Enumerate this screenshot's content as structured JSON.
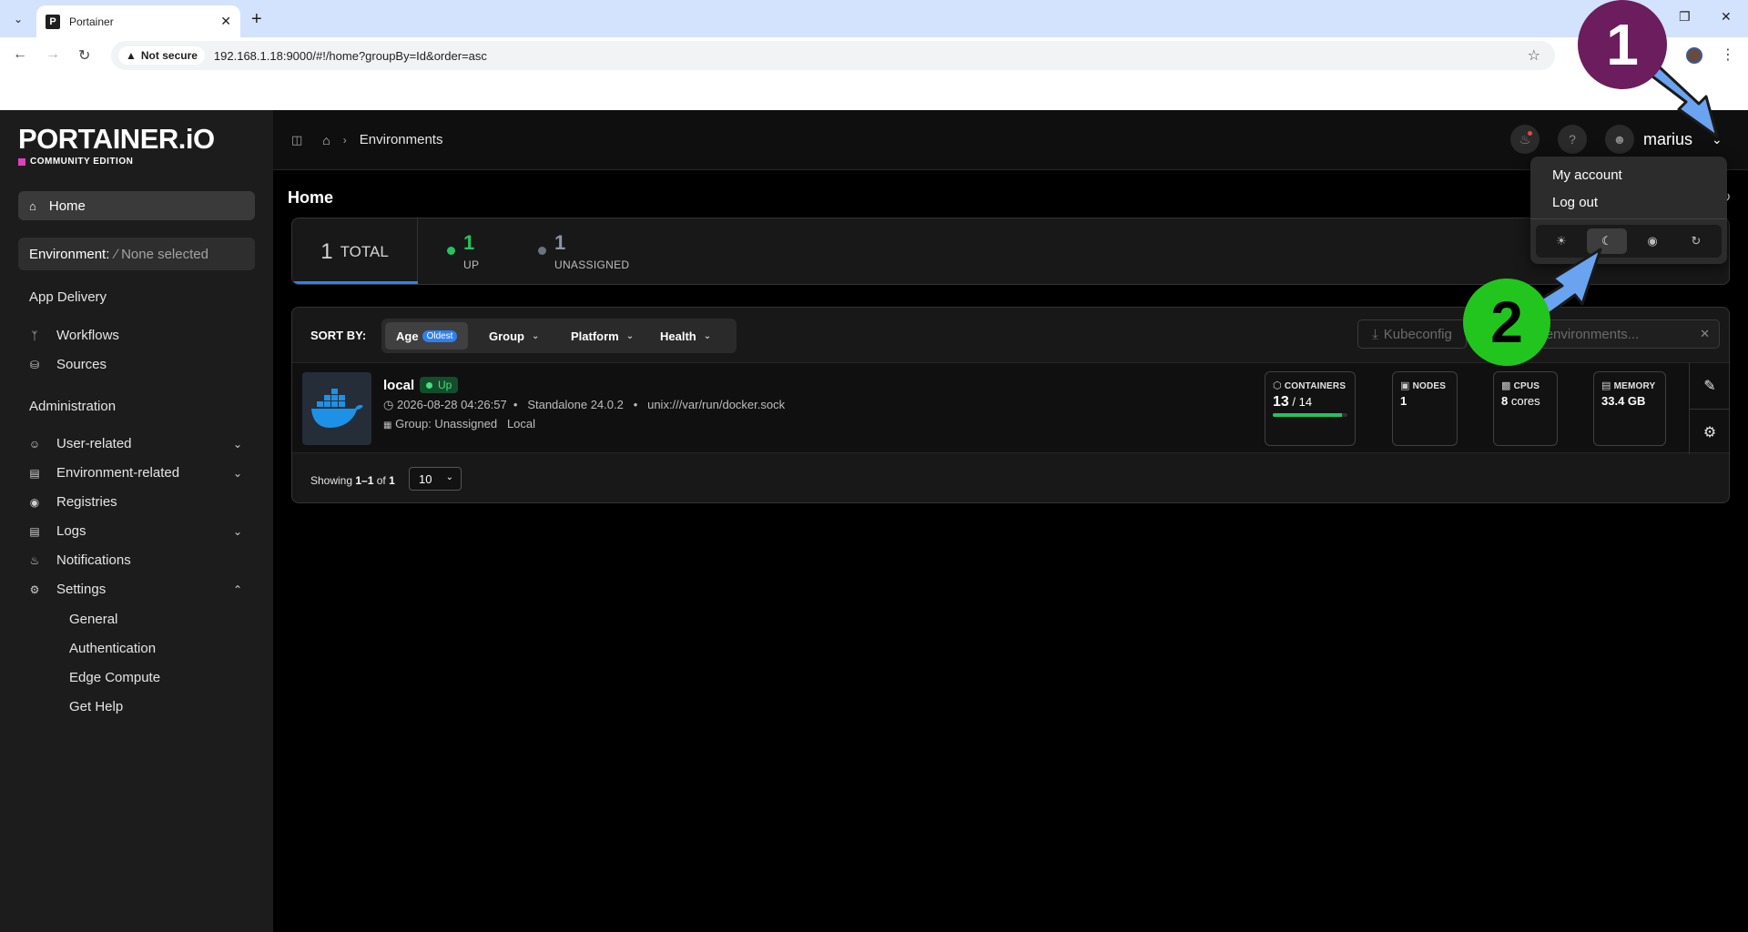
{
  "browser": {
    "tab_title": "Portainer",
    "favicon_letter": "P",
    "security_label": "Not secure",
    "url": "192.168.1.18:9000/#!/home?groupBy=Id&order=asc"
  },
  "logo": {
    "wordmark": "PORTAINER.iO",
    "edition": "COMMUNITY EDITION"
  },
  "sidebar": {
    "home": "Home",
    "environment_label": "Environment:",
    "environment_value": "None selected",
    "app_delivery": "App Delivery",
    "workflows": "Workflows",
    "sources": "Sources",
    "administration": "Administration",
    "user_related": "User-related",
    "environment_related": "Environment-related",
    "registries": "Registries",
    "logs": "Logs",
    "notifications": "Notifications",
    "settings": "Settings",
    "settings_sub": {
      "general": "General",
      "authentication": "Authentication",
      "edge_compute": "Edge Compute",
      "get_help": "Get Help"
    }
  },
  "topbar": {
    "breadcrumb": "Environments",
    "username": "marius"
  },
  "page": {
    "title": "Home"
  },
  "stats": {
    "total_num": "1",
    "total_label": "TOTAL",
    "up_num": "1",
    "up_label": "UP",
    "unassigned_num": "1",
    "unassigned_label": "UNASSIGNED"
  },
  "toolbar": {
    "sort_label": "SORT BY:",
    "sort_age": "Age",
    "sort_age_badge": "Oldest",
    "sort_group": "Group",
    "sort_platform": "Platform",
    "sort_health": "Health",
    "kubeconfig": "Kubeconfig",
    "search_placeholder": "Search environments..."
  },
  "environment": {
    "name": "local",
    "status": "Up",
    "timestamp": "2026-08-28 04:26:57",
    "type": "Standalone 24.0.2",
    "socket": "unix:///var/run/docker.sock",
    "group": "Group: Unassigned",
    "tag": "Local",
    "containers_label": "CONTAINERS",
    "containers_running": "13",
    "containers_total": "14",
    "containers_fraction": 0.93,
    "nodes_label": "NODES",
    "nodes_value": "1",
    "cpus_label": "CPUS",
    "cpus_num": "8",
    "cpus_unit": "cores",
    "memory_label": "MEMORY",
    "memory_value": "33.4 GB"
  },
  "pagination": {
    "showing_prefix": "Showing",
    "range": "1–1",
    "of": "of",
    "total": "1",
    "page_size": "10"
  },
  "user_menu": {
    "my_account": "My account",
    "log_out": "Log out"
  },
  "annotations": {
    "step1": "1",
    "step2": "2"
  },
  "colors": {
    "accent_blue": "#2f80ed",
    "status_green": "#22c55e",
    "callout_purple": "#6b1d5e",
    "callout_green": "#22c51e",
    "arrow_blue": "#6aa3f0"
  }
}
